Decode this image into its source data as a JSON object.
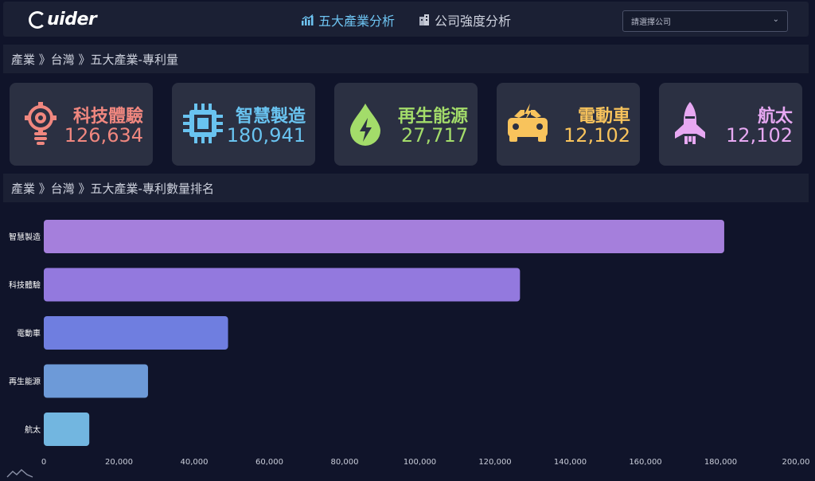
{
  "header": {
    "logo_text": "uider",
    "tabs": [
      {
        "label": "五大產業分析",
        "icon": "bar-chart-icon",
        "active": true
      },
      {
        "label": "公司強度分析",
        "icon": "building-icon",
        "active": false
      }
    ],
    "company_select": {
      "placeholder": "請選擇公司"
    }
  },
  "breadcrumbs": {
    "summary": "產業 》台灣 》五大產業-專利量",
    "ranking": "產業 》台灣 》五大產業-專利數量排名"
  },
  "cards": [
    {
      "label": "科技體驗",
      "value": "126,634",
      "color": "#f0877f",
      "icon": "lightbulb-gear-icon"
    },
    {
      "label": "智慧製造",
      "value": "180,941",
      "color": "#69c3f0",
      "icon": "chip-icon"
    },
    {
      "label": "再生能源",
      "value": "27,717",
      "color": "#a3dc6a",
      "icon": "energy-drop-icon"
    },
    {
      "label": "電動車",
      "value": "12,102",
      "color": "#f8c35c",
      "icon": "electric-car-icon"
    },
    {
      "label": "航太",
      "value": "12,102",
      "color": "#e7a8f2",
      "icon": "rocket-icon"
    }
  ],
  "chart_data": {
    "type": "bar",
    "orientation": "horizontal",
    "categories": [
      "智慧製造",
      "科技體驗",
      "電動車",
      "再生能源",
      "航太"
    ],
    "values": [
      180941,
      126634,
      49000,
      27717,
      12102
    ],
    "bar_colors": [
      "#a57fdc",
      "#9379de",
      "#6f7ee0",
      "#6d9ad8",
      "#72b6e0"
    ],
    "xlim": [
      0,
      200000
    ],
    "xticks": [
      0,
      20000,
      40000,
      60000,
      80000,
      100000,
      120000,
      140000,
      160000,
      180000,
      200000
    ],
    "xtick_labels": [
      "0",
      "20,000",
      "40,000",
      "60,000",
      "80,000",
      "100,000",
      "120,000",
      "140,000",
      "160,000",
      "180,000",
      "200,00"
    ],
    "grid": false,
    "legend": "none"
  }
}
